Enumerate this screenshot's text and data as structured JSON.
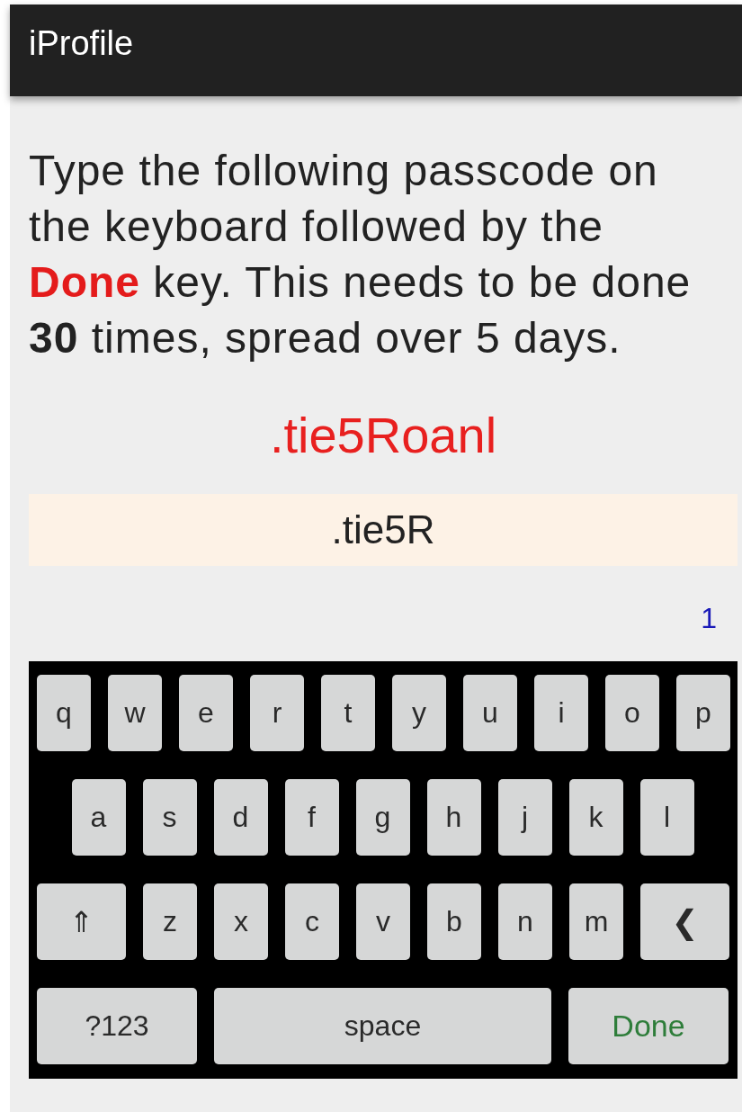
{
  "app_bar": {
    "title": "iProfile"
  },
  "instructions": [
    {
      "text": "Type the following passcode on the keyboard followed by the ",
      "kind": "plain"
    },
    {
      "text": "Done",
      "kind": "key"
    },
    {
      "text": " key. This needs to be done ",
      "kind": "plain"
    },
    {
      "text": "30",
      "kind": "bold"
    },
    {
      "text": " times, spread over 5 days.",
      "kind": "plain"
    }
  ],
  "passcode": ".tie5Roanl",
  "entry_field": {
    "value": ".tie5R"
  },
  "attempt_count": "1",
  "keyboard": {
    "rows": [
      {
        "keys": [
          {
            "label": "q",
            "kind": "letter"
          },
          {
            "label": "w",
            "kind": "letter"
          },
          {
            "label": "e",
            "kind": "letter"
          },
          {
            "label": "r",
            "kind": "letter"
          },
          {
            "label": "t",
            "kind": "letter"
          },
          {
            "label": "y",
            "kind": "letter"
          },
          {
            "label": "u",
            "kind": "letter"
          },
          {
            "label": "i",
            "kind": "letter"
          },
          {
            "label": "o",
            "kind": "letter"
          },
          {
            "label": "p",
            "kind": "letter"
          }
        ]
      },
      {
        "keys": [
          {
            "label": "a",
            "kind": "letter"
          },
          {
            "label": "s",
            "kind": "letter"
          },
          {
            "label": "d",
            "kind": "letter"
          },
          {
            "label": "f",
            "kind": "letter"
          },
          {
            "label": "g",
            "kind": "letter"
          },
          {
            "label": "h",
            "kind": "letter"
          },
          {
            "label": "j",
            "kind": "letter"
          },
          {
            "label": "k",
            "kind": "letter"
          },
          {
            "label": "l",
            "kind": "letter"
          }
        ]
      },
      {
        "keys": [
          {
            "label": "⇑",
            "kind": "shift"
          },
          {
            "label": "z",
            "kind": "letter"
          },
          {
            "label": "x",
            "kind": "letter"
          },
          {
            "label": "c",
            "kind": "letter"
          },
          {
            "label": "v",
            "kind": "letter"
          },
          {
            "label": "b",
            "kind": "letter"
          },
          {
            "label": "n",
            "kind": "letter"
          },
          {
            "label": "m",
            "kind": "letter"
          },
          {
            "label": "❮",
            "kind": "backspace"
          }
        ]
      },
      {
        "keys": [
          {
            "label": "?123",
            "kind": "symbols"
          },
          {
            "label": "space",
            "kind": "space"
          },
          {
            "label": "Done",
            "kind": "done"
          }
        ]
      }
    ]
  }
}
